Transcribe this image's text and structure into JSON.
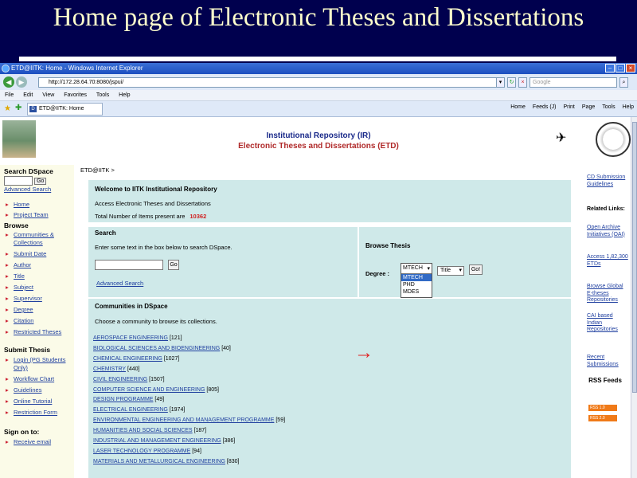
{
  "slide_title": "Home page of Electronic Theses and Dissertations",
  "browser": {
    "window_title": "ETD@IITK: Home - Windows Internet Explorer",
    "address": "http://172.28.64.70:8080/jspui/",
    "search_placeholder": "Google",
    "menu": [
      "File",
      "Edit",
      "View",
      "Favorites",
      "Tools",
      "Help"
    ],
    "tab_label": "ETD@IITK: Home",
    "toolbar": [
      "Home",
      "Feeds (J)",
      "Print",
      "Page",
      "Tools",
      "Help"
    ]
  },
  "banner": {
    "line1": "Institutional Repository (IR)",
    "line2": "Electronic Theses and Dissertations (ETD)"
  },
  "leftnav": {
    "search_heading": "Search DSpace",
    "go": "Go",
    "advanced": "Advanced Search",
    "home": "Home",
    "project_team": "Project Team",
    "browse_heading": "Browse",
    "browse_items": [
      "Communities & Collections",
      "Submit Date",
      "Author",
      "Title",
      "Subject",
      "Supervisor",
      "Degree",
      "Citation",
      "Restricted Theses"
    ],
    "submit_heading": "Submit Thesis",
    "submit_items": [
      "Login (PG Students Only)",
      "Workflow Chart",
      "Guidelines",
      "Online Tutorial",
      "Restriction Form"
    ],
    "signon_heading": "Sign on to:",
    "signon_items": [
      "Receive email"
    ]
  },
  "main": {
    "breadcrumb": "ETD@IITK >",
    "welcome_title": "Welcome to IITK Institutional Repository",
    "welcome_sub": "Access Electronic Theses and Dissertations",
    "total_label": "Total Number of Items present are",
    "total_value": "10362",
    "search_title": "Search",
    "search_hint": "Enter some text in the box below to search DSpace.",
    "search_go": "Go",
    "advanced": "Advanced Search",
    "browse_title": "Browse Thesis",
    "degree_label": "Degree :",
    "degree_selected": "MTECH",
    "degree_options": [
      "MTECH",
      "PHD",
      "MDES"
    ],
    "sort_selected": "Title",
    "browse_go": "Go!",
    "communities_title": "Communities in DSpace",
    "communities_hint": "Choose a community to browse its collections.",
    "communities": [
      {
        "name": "AEROSPACE ENGINEERING",
        "count": "[121]"
      },
      {
        "name": "BIOLOGICAL SCIENCES AND BIOENGINEERING",
        "count": "[40]"
      },
      {
        "name": "CHEMICAL ENGINEERING",
        "count": "[1027]"
      },
      {
        "name": "CHEMISTRY",
        "count": "[440]"
      },
      {
        "name": "CIVIL ENGINEERING",
        "count": "[1507]"
      },
      {
        "name": "COMPUTER SCIENCE AND ENGINEERING",
        "count": "[805]"
      },
      {
        "name": "DESIGN PROGRAMME",
        "count": "[49]"
      },
      {
        "name": "ELECTRICAL ENGINEERING",
        "count": "[1974]"
      },
      {
        "name": "ENVIRONMENTAL ENGINEERING AND MANAGEMENT PROGRAMME",
        "count": "[59]"
      },
      {
        "name": "HUMANITIES AND SOCIAL SCIENCES",
        "count": "[187]"
      },
      {
        "name": "INDUSTRIAL AND MANAGEMENT ENGINEERING",
        "count": "[386]"
      },
      {
        "name": "LASER TECHNOLOGY PROGRAMME",
        "count": "[94]"
      },
      {
        "name": "MATERIALS AND METALLURGICAL ENGINEERING",
        "count": "[830]"
      }
    ]
  },
  "rightnav": {
    "cd_submission": "CD Submission Guidelines",
    "related": "Related Links:",
    "oai": "Open Archive Initiatives (OAI)",
    "access": "Access 1,82,300 ETDs",
    "global": "Browse Global E-theses Repositories",
    "cai": "CAI based Indian Repositories",
    "recent": "Recent Submissions",
    "rss": "RSS Feeds",
    "rss1": "RSS 1.0",
    "rss2": "RSS 2.0"
  }
}
